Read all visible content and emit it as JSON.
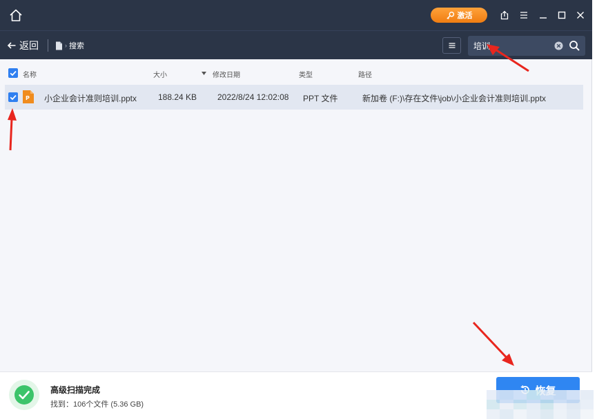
{
  "titlebar": {
    "activate_label": "激活",
    "icons": [
      "home-icon",
      "key-icon",
      "share-icon",
      "menu-icon",
      "minimize-icon",
      "maximize-icon",
      "close-icon"
    ]
  },
  "navbar": {
    "back_label": "返回",
    "breadcrumb": "搜索",
    "search": {
      "value": "培训"
    }
  },
  "table": {
    "headers": {
      "name": "名称",
      "size": "大小",
      "modified": "修改日期",
      "type": "类型",
      "path": "路径"
    },
    "rows": [
      {
        "checked": true,
        "name": "小企业会计准则培训.pptx",
        "size": "188.24 KB",
        "modified": "2022/8/24 12:02:08",
        "type": "PPT 文件",
        "path": "新加卷 (F:)\\存在文件\\job\\小企业会计准则培训.pptx"
      }
    ]
  },
  "status": {
    "title": "高级扫描完成",
    "found": "找到：106个文件 (5.36 GB)"
  },
  "recover_label": "恢复",
  "colors": {
    "titlebar": "#2b3547",
    "accent": "#2f86f2",
    "activate": "#f5891f",
    "arrow": "#e8261e",
    "success": "#3cc46a"
  }
}
